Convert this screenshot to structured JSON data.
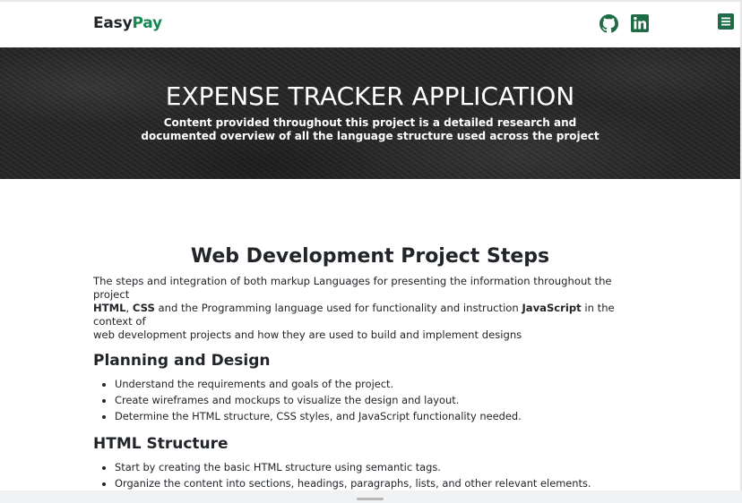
{
  "navbar": {
    "brand_part1": "Easy",
    "brand_part2": "Pay",
    "icons": [
      "github-icon",
      "linkedin-icon",
      "menu-icon"
    ],
    "accent_color": "#198754"
  },
  "hero": {
    "title": "EXPENSE TRACKER APPLICATION",
    "subtitle_line1": "Content provided throughout this project is a detailed research and",
    "subtitle_line2": "documented overview of all the language structure used across the project"
  },
  "main": {
    "section_title": "Web Development Project Steps",
    "intro": {
      "line1": "The steps and integration of both markup Languages for presenting the information throughout the project",
      "html_label": "HTML",
      "comma": ", ",
      "css_label": "CSS",
      "middle": " and the Programming language used for functionality and instruction ",
      "js_label": "JavaScript",
      "end_line2": " in the context of",
      "line3": "web development projects and how they are used to build and implement designs"
    },
    "planning": {
      "heading": "Planning and Design",
      "items": [
        "Understand the requirements and goals of the project.",
        "Create wireframes and mockups to visualize the design and layout.",
        "Determine the HTML structure, CSS styles, and JavaScript functionality needed."
      ]
    },
    "html_structure": {
      "heading": "HTML Structure",
      "items": [
        "Start by creating the basic HTML structure using semantic tags.",
        "Organize the content into sections, headings, paragraphs, lists, and other relevant elements."
      ]
    }
  }
}
